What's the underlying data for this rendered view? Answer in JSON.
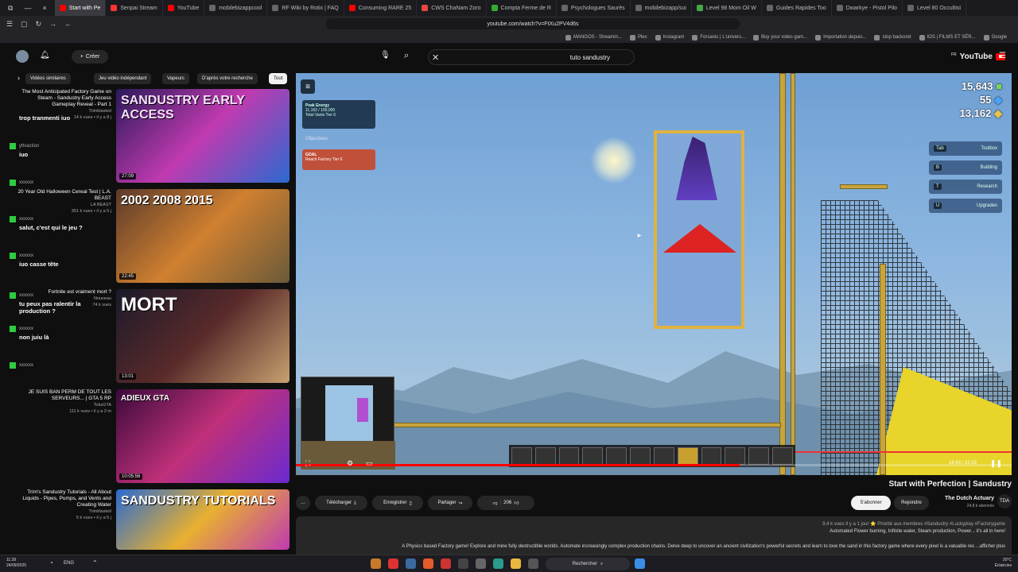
{
  "browser": {
    "tabs": [
      "Start with Pe",
      "Senpai Stream",
      "YouTube",
      "mobilebizappcool",
      "RF Wiki by Rotix | FAQ",
      "Consuming RARE 25",
      "CWS ChaNam Zoro",
      "Compta Ferme de R",
      "Psychologues Saurès",
      "mobilebizapp/sui",
      "Level 98 Mom Oil W",
      "Guides Rapides Too",
      "Dwarkye - Pistol Pilo",
      "Level 80 Occultist"
    ],
    "window_controls": [
      "⧉",
      "—",
      "×"
    ],
    "url": "youtube.com/watch?v=FtXu2PV4d6s",
    "bookmarks": [
      "Google",
      "IOS | FILMS ET SÉR...",
      "stop backoret",
      "Importation depuis...",
      "Buy your video gam...",
      "Forsanic | L'univers...",
      "Instagram",
      "Plex",
      "MANGOS - Streamin..."
    ]
  },
  "youtube": {
    "logo_text": "YouTube",
    "logo_region": "FR",
    "search_value": "tuto sandustry",
    "create_label": "Créer"
  },
  "player": {
    "stats": [
      "15,643",
      "55",
      "13,162"
    ],
    "stat_colors": [
      "#7cd35a",
      "#4aa3ff",
      "#e8c34a"
    ],
    "menu": [
      {
        "label": "Toolbox",
        "key": "Tab"
      },
      {
        "label": "Building",
        "key": "B"
      },
      {
        "label": "Research",
        "key": "T"
      },
      {
        "label": "Upgrades",
        "key": "U"
      }
    ],
    "hud_energy_title": "Peak Energy",
    "hud_energy_lines": [
      "11,162 / 100,000",
      "Total Vanis Tier 6"
    ],
    "objectives_label": "Objectives",
    "hud_goal_title": "GOAL",
    "hud_goal_text": "Reach Factory Tier 6",
    "time_current": "18:43",
    "time_total": "21:03",
    "progress": 0.62
  },
  "video": {
    "title": "Start with Perfection | Sandustry",
    "channel_name": "The Dutch Actuary",
    "channel_subs": "24,8 k abonnés",
    "channel_initials": "TDA",
    "join_label": "Rejoindre",
    "subscribe_label": "S'abonner",
    "likes": "206",
    "share_label": "Partager",
    "save_label": "Enregistrer",
    "download_label": "Télécharger",
    "more_label": "…",
    "desc_meta": "9,4 k vues  Il y a 1 jour  ⭐ Priorité aux membres  #Sandustry #Luckyplay #Factorygame",
    "desc_lines": [
      "Automated Flower burning, Infinite water, Steam production, Power... it's all in here!",
      "A Physics based Factory game! Explore and mine fully destructible worlds. Automate increasingly complex production chains. Delve deep to uncover an ancient civilization's powerful secrets and learn to love the sand in this factory game where every pixel is a valuable res ...afficher plus"
    ]
  },
  "chips": [
    "Tout",
    "D'après votre recherche",
    "Vapeurs",
    "Jeu vidéo indépendant",
    "Vidéos similaires"
  ],
  "chat": [
    {
      "user": "",
      "text": "trop tranmenti iuo"
    },
    {
      "user": "yttvaction",
      "text": "iuo"
    },
    {
      "user": "xxxxxx",
      "text": ""
    },
    {
      "user": "xxxxxx",
      "text": "salut, c'est qui le jeu ?"
    },
    {
      "user": "xxxxxx",
      "text": "iuo casse tête"
    },
    {
      "user": "xxxxxx",
      "text": "tu peux pas ralentir la production ?"
    },
    {
      "user": "xxxxxx",
      "text": "non juiu là"
    },
    {
      "user": "xxxxxx",
      "text": ""
    }
  ],
  "recommendations": [
    {
      "thumb_text": "SANDUSTRY EARLY ACCESS",
      "duration": "27:09",
      "title": "The Most Anticipated Factory Game on Steam - Sandustry Early Access Gameplay Reveal - Part 1",
      "channel": "Trimblasted",
      "views": "14 k vues • il y a 8 j"
    },
    {
      "thumb_text": "2002 2008 2015",
      "duration": "22:45",
      "title": "20 Year Old Halloween Cereal Test | L.A. BEAST",
      "channel": "LA BEAST",
      "views": "351 k vues • il y a 5 j"
    },
    {
      "thumb_text": "MORT",
      "duration": "13:01",
      "title": "Fortnite est vraiment mort ?",
      "channel": "Nouveau",
      "views": "74 k vues"
    },
    {
      "thumb_text": "ADIEUX GTA",
      "duration": "10:05:56",
      "title": "JE SUIS BAN PERM DE TOUT LES SERVEURS... | GTA 5 RP",
      "channel": "ToksGTA",
      "views": "111 k vues • il y a 2 m"
    },
    {
      "thumb_text": "SANDUSTRY TUTORIALS",
      "duration": "",
      "title": "Trim's Sandustry Tutorials - All About Liquids - Pipes, Pumps, and Vents and Creating Water",
      "channel": "Trimblasted",
      "views": "5 k vues • il y a 5 j"
    }
  ],
  "taskbar": {
    "search": "Rechercher",
    "time": "11:39",
    "date": "24/09/2025",
    "lang": "ENG",
    "weather": "20°C",
    "weather_desc": "Éclaircies"
  }
}
